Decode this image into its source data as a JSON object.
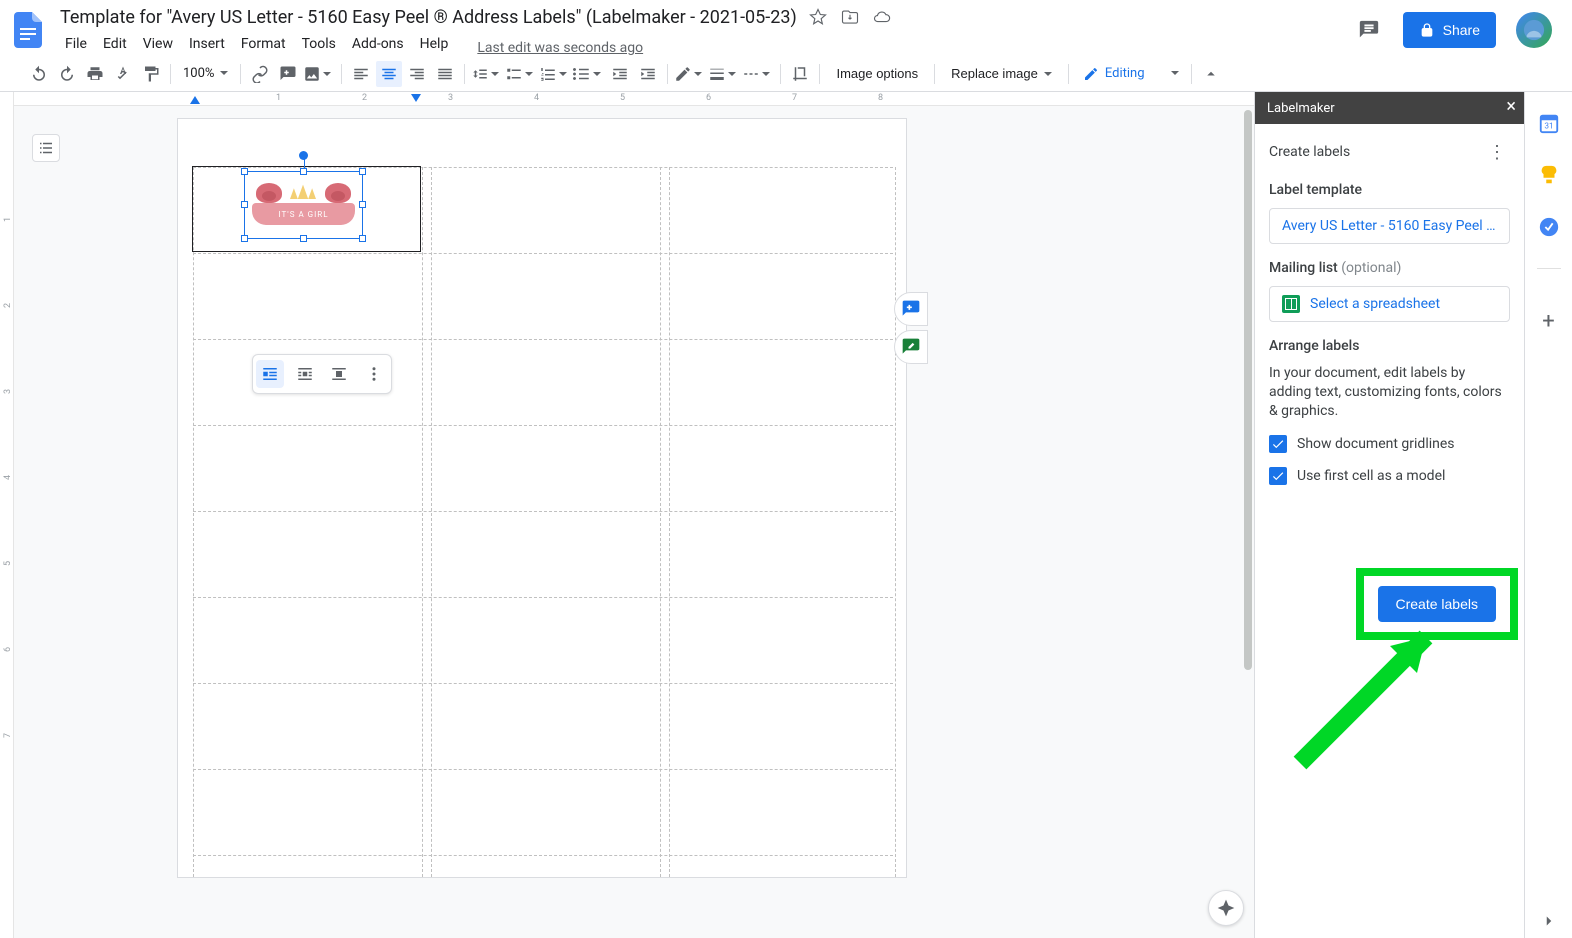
{
  "doc": {
    "title": "Template for \"Avery US Letter - 5160 Easy Peel ® Address Labels\" (Labelmaker - 2021-05-23)",
    "last_edit": "Last edit was seconds ago"
  },
  "menu": {
    "file": "File",
    "edit": "Edit",
    "view": "View",
    "insert": "Insert",
    "format": "Format",
    "tools": "Tools",
    "addons": "Add-ons",
    "help": "Help"
  },
  "toolbar": {
    "zoom": "100%",
    "image_options": "Image options",
    "replace_image": "Replace image",
    "editing": "Editing"
  },
  "buttons": {
    "share": "Share"
  },
  "ruler": {
    "labels": [
      "1",
      "2",
      "3",
      "4",
      "5",
      "6",
      "7",
      "8"
    ]
  },
  "label_art": {
    "text": "IT'S A GIRL"
  },
  "labelmaker": {
    "title": "Labelmaker",
    "create_labels_head": "Create labels",
    "template_section": "Label template",
    "template_value": "Avery US Letter - 5160 Easy Peel ®...",
    "mailing_section": "Mailing list ",
    "mailing_optional": "(optional)",
    "select_spreadsheet": "Select a spreadsheet",
    "arrange_section": "Arrange labels",
    "arrange_desc": "In your document, edit labels by adding text, customizing fonts, colors & graphics.",
    "cb_gridlines": "Show document gridlines",
    "cb_firstcell": "Use first cell as a model",
    "create": "Create labels"
  }
}
